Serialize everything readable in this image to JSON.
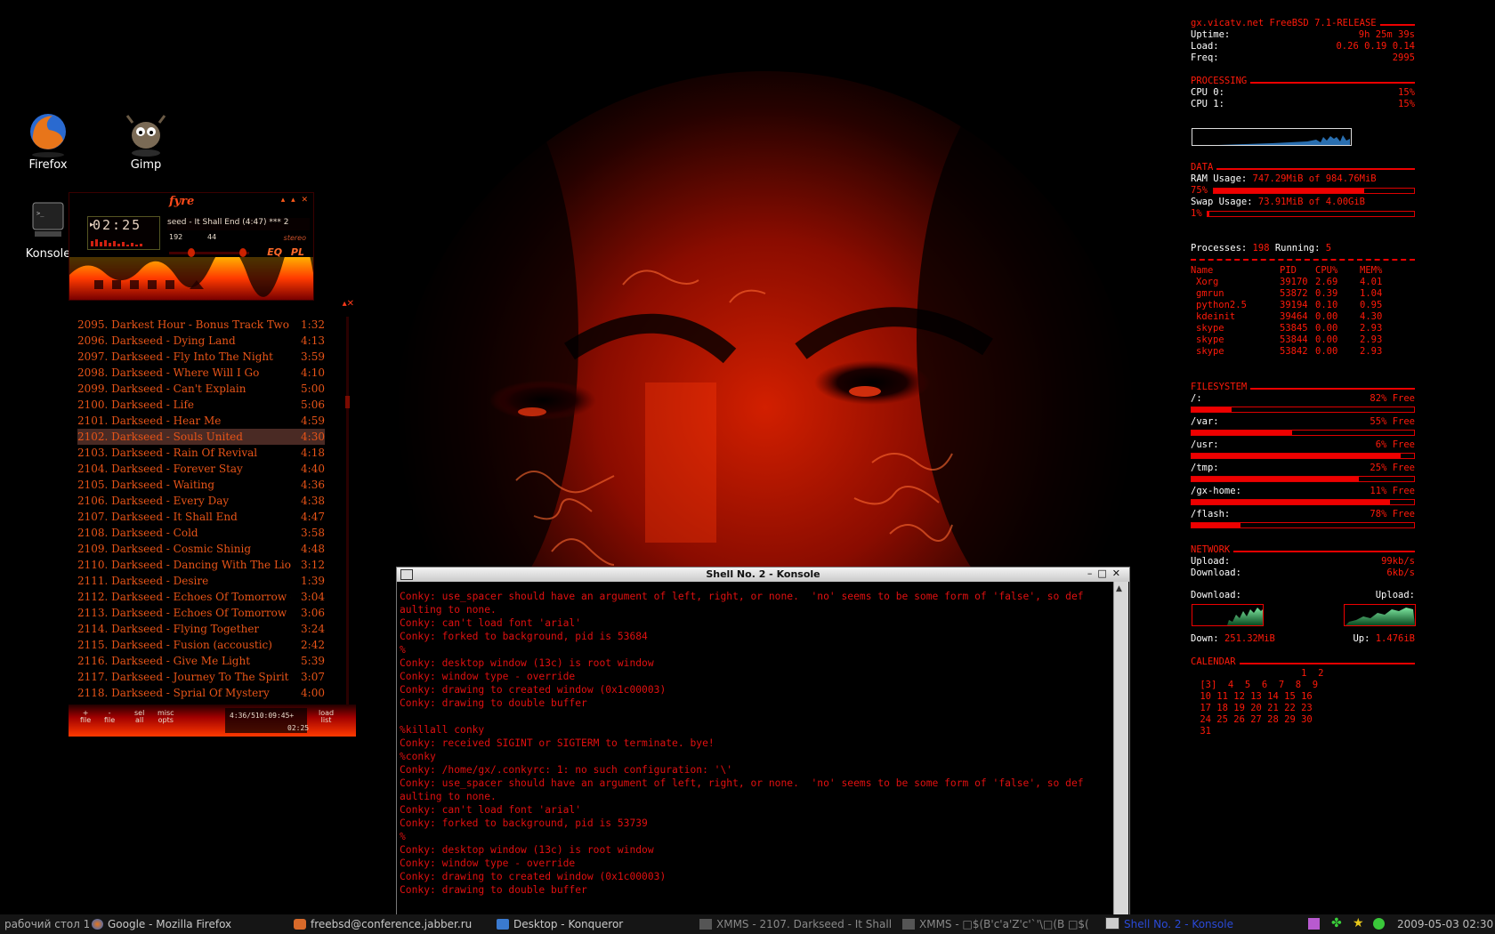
{
  "desktop": {
    "icons": [
      {
        "label": "Firefox"
      },
      {
        "label": "Gimp"
      },
      {
        "label": "Konsole"
      }
    ]
  },
  "xmms": {
    "title": "fyre",
    "time": "02:25",
    "song_ticker": "seed - It Shall End (4:47)  ***  2",
    "kbps": "192",
    "khz": "44",
    "stereo": "stereo",
    "eq_pl": "EQ PL",
    "controls": "▴ ▴ ✕"
  },
  "playlist": {
    "items": [
      {
        "title": "2095. Darkest Hour - Bonus Track Two",
        "duration": "1:32"
      },
      {
        "title": "2096. Darkseed - Dying Land",
        "duration": "4:13"
      },
      {
        "title": "2097. Darkseed - Fly Into The Night",
        "duration": "3:59"
      },
      {
        "title": "2098. Darkseed - Where Will I Go",
        "duration": "4:10"
      },
      {
        "title": "2099. Darkseed - Can't Explain",
        "duration": "5:00"
      },
      {
        "title": "2100. Darkseed - Life",
        "duration": "5:06"
      },
      {
        "title": "2101. Darkseed - Hear Me",
        "duration": "4:59"
      },
      {
        "title": "2102. Darkseed - Souls United",
        "duration": "4:30"
      },
      {
        "title": "2103. Darkseed - Rain Of Revival",
        "duration": "4:18"
      },
      {
        "title": "2104. Darkseed - Forever Stay",
        "duration": "4:40"
      },
      {
        "title": "2105. Darkseed - Waiting",
        "duration": "4:36"
      },
      {
        "title": "2106. Darkseed - Every Day",
        "duration": "4:38"
      },
      {
        "title": "2107. Darkseed - It Shall End",
        "duration": "4:47"
      },
      {
        "title": "2108. Darkseed - Cold",
        "duration": "3:58"
      },
      {
        "title": "2109. Darkseed - Cosmic Shinig",
        "duration": "4:48"
      },
      {
        "title": "2110. Darkseed - Dancing With The Lion",
        "duration": "3:12"
      },
      {
        "title": "2111. Darkseed - Desire",
        "duration": "1:39"
      },
      {
        "title": "2112. Darkseed - Echoes Of Tomorrow (...",
        "duration": "3:04"
      },
      {
        "title": "2113. Darkseed - Echoes Of Tomorrow",
        "duration": "3:06"
      },
      {
        "title": "2114. Darkseed - Flying Together",
        "duration": "3:24"
      },
      {
        "title": "2115. Darkseed - Fusion (accoustic)",
        "duration": "2:42"
      },
      {
        "title": "2116. Darkseed - Give Me Light",
        "duration": "5:39"
      },
      {
        "title": "2117. Darkseed - Journey To The Spirit ...",
        "duration": "3:07"
      },
      {
        "title": "2118. Darkseed - Sprial Of Mystery",
        "duration": "4:00"
      }
    ],
    "selected_index": 7,
    "buttons": {
      "add": "+\nfile",
      "remove": "-\nfile",
      "select": "sel\nall",
      "misc": "misc\nopts",
      "list": "load\nlist"
    },
    "total_time": "4:36/510:09:45+",
    "elapsed": "02:25"
  },
  "konsole": {
    "title": "Shell No. 2 - Konsole",
    "lines": [
      "Conky: use_spacer should have an argument of left, right, or none.  'no' seems to be some form of 'false', so def",
      "aulting to none.",
      "Conky: can't load font 'arial'",
      "Conky: forked to background, pid is 53684",
      "%",
      "Conky: desktop window (13c) is root window",
      "Conky: window type - override",
      "Conky: drawing to created window (0x1c00003)",
      "Conky: drawing to double buffer",
      "",
      "%killall conky",
      "Conky: received SIGINT or SIGTERM to terminate. bye!",
      "%conky",
      "Conky: /home/gx/.conkyrc: 1: no such configuration: '\\'",
      "Conky: use_spacer should have an argument of left, right, or none.  'no' seems to be some form of 'false', so def",
      "aulting to none.",
      "Conky: can't load font 'arial'",
      "Conky: forked to background, pid is 53739",
      "%",
      "Conky: desktop window (13c) is root window",
      "Conky: window type - override",
      "Conky: drawing to created window (0x1c00003)",
      "Conky: drawing to double buffer"
    ]
  },
  "conky": {
    "host": "gx.vicatv.net FreeBSD 7.1-RELEASE",
    "uptime_label": "Uptime:",
    "uptime": "9h 25m 39s",
    "load_label": "Load:",
    "load": "0.26 0.19 0.14",
    "freq_label": "Freq:",
    "freq": "2995",
    "processing_hdr": "PROCESSING",
    "cpu0_label": "CPU 0:",
    "cpu0": "15%",
    "cpu1_label": "CPU 1:",
    "cpu1": "15%",
    "data_hdr": "DATA",
    "ram_label": "RAM Usage:",
    "ram": "747.29MiB of 984.76MiB",
    "ram_pct": "75%",
    "ram_fraction": 0.75,
    "swap_label": "Swap Usage:",
    "swap": "73.91MiB of 4.00GiB",
    "swap_pct": "1%",
    "swap_fraction": 0.01,
    "processes_label": "Processes:",
    "processes": "198",
    "running_label": "Running:",
    "running": "5",
    "proc_header": [
      "Name",
      "PID",
      "CPU%",
      "MEM%"
    ],
    "procs": [
      [
        "Xorg",
        "39170",
        "2.69",
        "4.01"
      ],
      [
        "gmrun",
        "53872",
        "0.39",
        "1.04"
      ],
      [
        "python2.5",
        "39194",
        "0.10",
        "0.95"
      ],
      [
        "kdeinit",
        "39464",
        "0.00",
        "4.30"
      ],
      [
        "skype",
        "53845",
        "0.00",
        "2.93"
      ],
      [
        "skype",
        "53844",
        "0.00",
        "2.93"
      ],
      [
        "skype",
        "53842",
        "0.00",
        "2.93"
      ]
    ],
    "fs_hdr": "FILESYSTEM",
    "fs": [
      {
        "mount": "/:",
        "free": "82% Free",
        "used_fraction": 0.18
      },
      {
        "mount": "/var:",
        "free": "55% Free",
        "used_fraction": 0.45
      },
      {
        "mount": "/usr:",
        "free": "6% Free",
        "used_fraction": 0.94
      },
      {
        "mount": "/tmp:",
        "free": "25% Free",
        "used_fraction": 0.75
      },
      {
        "mount": "/gx-home:",
        "free": "11% Free",
        "used_fraction": 0.89
      },
      {
        "mount": "/flash:",
        "free": "78% Free",
        "used_fraction": 0.22
      }
    ],
    "net_hdr": "NETWORK",
    "upload_label": "Upload:",
    "upload": "99kb/s",
    "download_label": "Download:",
    "download": "6kb/s",
    "graph_down_label": "Download:",
    "graph_up_label": "Upload:",
    "down_total_label": "Down:",
    "down_total": "251.32MiB",
    "up_total_label": "Up:",
    "up_total": "1.476iB",
    "cal_hdr": "CALENDAR",
    "calendar": [
      "                   1  2",
      " [3]  4  5  6  7  8  9",
      " 10 11 12 13 14 15 16",
      " 17 18 19 20 21 22 23",
      " 24 25 26 27 28 29 30",
      " 31"
    ]
  },
  "taskbar": {
    "desktop_label": "рабочий стол 1",
    "tasks": [
      {
        "label": "Google - Mozilla Firefox"
      },
      {
        "label": "freebsd@conference.jabber.ru"
      },
      {
        "label": "Desktop - Konqueror"
      },
      {
        "label": "XMMS - 2107. Darkseed - It Shall"
      },
      {
        "label": "XMMS - □$(B'c'a'Z'c'`'\\□(B □$("
      },
      {
        "label": "Shell No. 2 - Konsole"
      }
    ],
    "clock": "2009-05-03 02:30"
  },
  "colors": {
    "accent": "#ff1a0a",
    "playlist_text": "#e85418",
    "terminal_text": "#e01010"
  }
}
